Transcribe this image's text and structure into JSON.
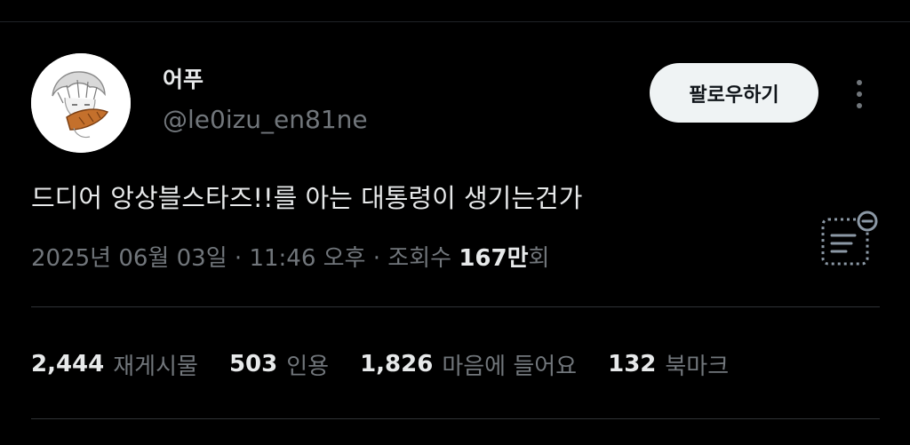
{
  "author": {
    "display_name": "어푸",
    "handle": "@le0izu_en81ne"
  },
  "follow_button_label": "팔로우하기",
  "tweet": {
    "text": "드디어 앙상블스타즈!!를 아는 대통령이 생기는건가",
    "date": "2025년 06월 03일",
    "separator": "·",
    "time": "11:46 오후",
    "views_prefix": "조회수",
    "views_count": "167만",
    "views_suffix": "회"
  },
  "stats": {
    "reposts": {
      "count": "2,444",
      "label": "재게시물"
    },
    "quotes": {
      "count": "503",
      "label": "인용"
    },
    "likes": {
      "count": "1,826",
      "label": "마음에 들어요"
    },
    "bookmarks": {
      "count": "132",
      "label": "북마크"
    }
  },
  "icons": {
    "more": "more-vertical-icon",
    "notes": "community-notes-icon"
  },
  "colors": {
    "background": "#000000",
    "primary_text": "#e7e9ea",
    "secondary_text": "#71767b",
    "follow_button_bg": "#eff3f4",
    "divider": "#2f3336"
  }
}
